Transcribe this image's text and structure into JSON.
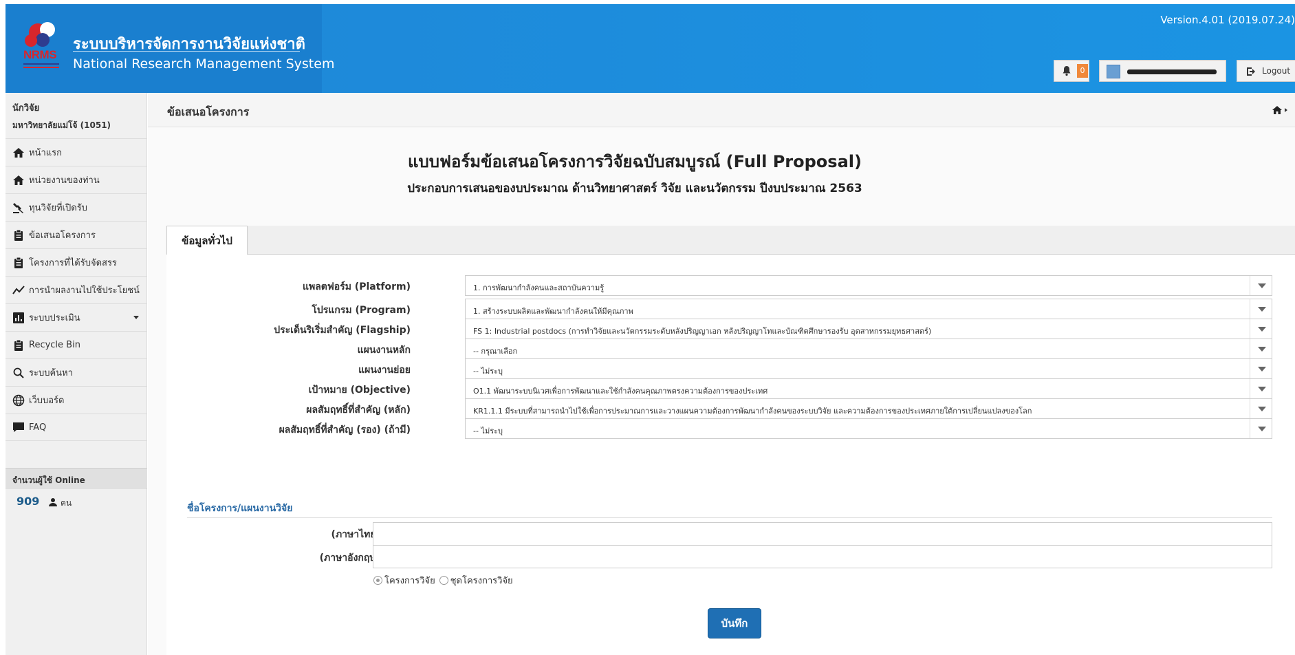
{
  "header": {
    "app_title_th": "ระบบบริหารจัดการงานวิจัยแห่งชาติ",
    "app_title_en": "National Research Management System",
    "logo_text": "NRMS",
    "version": "Version.4.01 (2019.07.24)",
    "notification_count": "0",
    "logout_label": "Logout"
  },
  "sidebar": {
    "role": "นักวิจัย",
    "organization": "มหาวิทยาลัยแม่โจ้ (1051)",
    "items": [
      {
        "label": "หน้าแรก",
        "icon": "home-icon"
      },
      {
        "label": "หน่วยงานของท่าน",
        "icon": "home-icon"
      },
      {
        "label": "ทุนวิจัยที่เปิดรับ",
        "icon": "gavel-icon"
      },
      {
        "label": "ข้อเสนอโครงการ",
        "icon": "clipboard-icon"
      },
      {
        "label": "โครงการที่ได้รับจัดสรร",
        "icon": "clipboard-icon"
      },
      {
        "label": "การนำผลงานไปใช้ประโยชน์",
        "icon": "trend-line-icon"
      },
      {
        "label": "ระบบประเมิน",
        "icon": "bar-chart-icon"
      },
      {
        "label": "Recycle Bin",
        "icon": "clipboard-icon"
      },
      {
        "label": "ระบบค้นหา",
        "icon": "search-icon"
      },
      {
        "label": "เว็บบอร์ด",
        "icon": "globe-icon"
      },
      {
        "label": "FAQ",
        "icon": "chat-icon"
      }
    ],
    "online_heading": "จำนวนผู้ใช้ Online",
    "online_count": "909",
    "online_unit": "คน"
  },
  "page": {
    "title": "ข้อเสนอโครงการ",
    "form_title": "แบบฟอร์มข้อเสนอโครงการวิจัยฉบับสมบูรณ์ (Full Proposal)",
    "form_subtitle": "ประกอบการเสนอของบประมาณ ด้านวิทยาศาสตร์ วิจัย และนวัตกรรม ปีงบประมาณ 2563",
    "tab_label": "ข้อมูลทั่วไป"
  },
  "form": {
    "fields": [
      {
        "label": "แพลตฟอร์ม (Platform)",
        "value": "1. การพัฒนากำลังคนและสถาบันความรู้"
      },
      {
        "label": "โปรแกรม (Program)",
        "value": "1. สร้างระบบผลิตและพัฒนากำลังคนให้มีคุณภาพ"
      },
      {
        "label": "ประเด็นริเริ่มสำคัญ (Flagship)",
        "value": "FS 1: Industrial postdocs (การทำวิจัยและนวัตกรรมระดับหลังปริญญาเอก หลังปริญญาโทและบัณฑิตศึกษารองรับ อุตสาหกรรมยุทธศาสตร์)"
      },
      {
        "label": "แผนงานหลัก",
        "value": "-- กรุณาเลือก"
      },
      {
        "label": "แผนงานย่อย",
        "value": "-- ไม่ระบุ"
      },
      {
        "label": "เป้าหมาย (Objective)",
        "value": "O1.1 พัฒนาระบบนิเวศเพื่อการพัฒนาและใช้กำลังคนคุณภาพตรงความต้องการของประเทศ"
      },
      {
        "label": "ผลสัมฤทธิ์ที่สำคัญ (หลัก)",
        "value": "KR1.1.1 มีระบบที่สามารถนำไปใช้เพื่อการประมาณการและวางแผนความต้องการพัฒนากำลังคนของระบบวิจัย และความต้องการของประเทศภายใต้การเปลี่ยนแปลงของโลก"
      },
      {
        "label": "ผลสัมฤทธิ์ที่สำคัญ (รอง) (ถ้ามี)",
        "value": "-- ไม่ระบุ"
      }
    ],
    "section_title": "ชื่อโครงการ/แผนงานวิจัย",
    "name_th_label": "(ภาษาไทย)",
    "name_th_value": "",
    "name_en_label": "(ภาษาอังกฤษ)",
    "name_en_value": "",
    "radio_options": [
      "โครงการวิจัย",
      "ชุดโครงการวิจัย"
    ],
    "radio_selected": "โครงการวิจัย",
    "save_label": "บันทึก"
  }
}
